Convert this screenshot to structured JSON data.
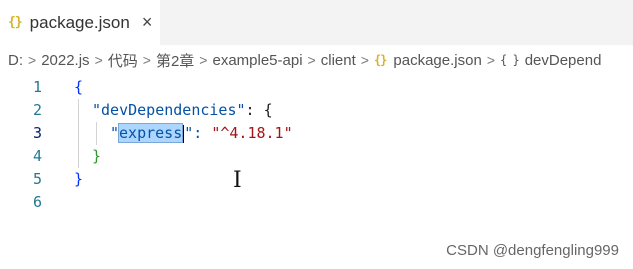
{
  "tab": {
    "icon": "{}",
    "label": "package.json",
    "close": "×"
  },
  "breadcrumb": {
    "items": [
      "D:",
      "2022.js",
      "代码",
      "第2章",
      "example5-api",
      "client"
    ],
    "file_icon": "{}",
    "file": "package.json",
    "obj_icon": "{ }",
    "last": "devDepend",
    "separator": ">"
  },
  "editor": {
    "lines": [
      {
        "num": "1"
      },
      {
        "num": "2"
      },
      {
        "num": "3"
      },
      {
        "num": "4"
      },
      {
        "num": "5"
      },
      {
        "num": "6"
      }
    ],
    "tokens": {
      "open_brace": "{",
      "dev_key": "\"devDependencies\"",
      "colon_brace": ": {",
      "quote_open": "\"",
      "express": "express",
      "quote_close_colon": "\":",
      "version": "\"^4.18.1\"",
      "inner_close": "}",
      "outer_close": "}"
    }
  },
  "cursor_glyph": "I",
  "watermark": "CSDN @dengfengling999"
}
